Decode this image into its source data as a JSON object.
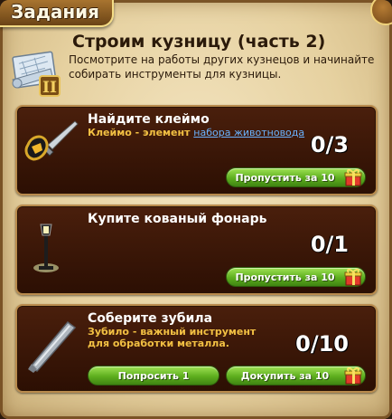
{
  "window": {
    "title": "Задания"
  },
  "quest": {
    "title": "Строим кузницу (часть 2)",
    "description": "Посмотрите на работы других кузнецов и начинайте собирать инструменты для кузницы.",
    "badge_roman": "II"
  },
  "tasks": [
    {
      "title": "Найдите клеймо",
      "desc_prefix": "Клеймо - элемент ",
      "desc_link": "набора животновода",
      "progress": "0/3",
      "skip_label": "Пропустить за 10"
    },
    {
      "title": "Купите кованый фонарь",
      "progress": "0/1",
      "skip_label": "Пропустить за 10"
    },
    {
      "title": "Соберите зубила",
      "desc": "Зубило - важный инструмент для обработки металла.",
      "progress": "0/10",
      "ask_label": "Попросить 1",
      "buy_label": "Докупить за 10"
    }
  ],
  "colors": {
    "accent_green": "#5dae1e",
    "card_bg": "#3a1606",
    "desc_yellow": "#f2c043",
    "link_blue": "#6ab3ff"
  }
}
